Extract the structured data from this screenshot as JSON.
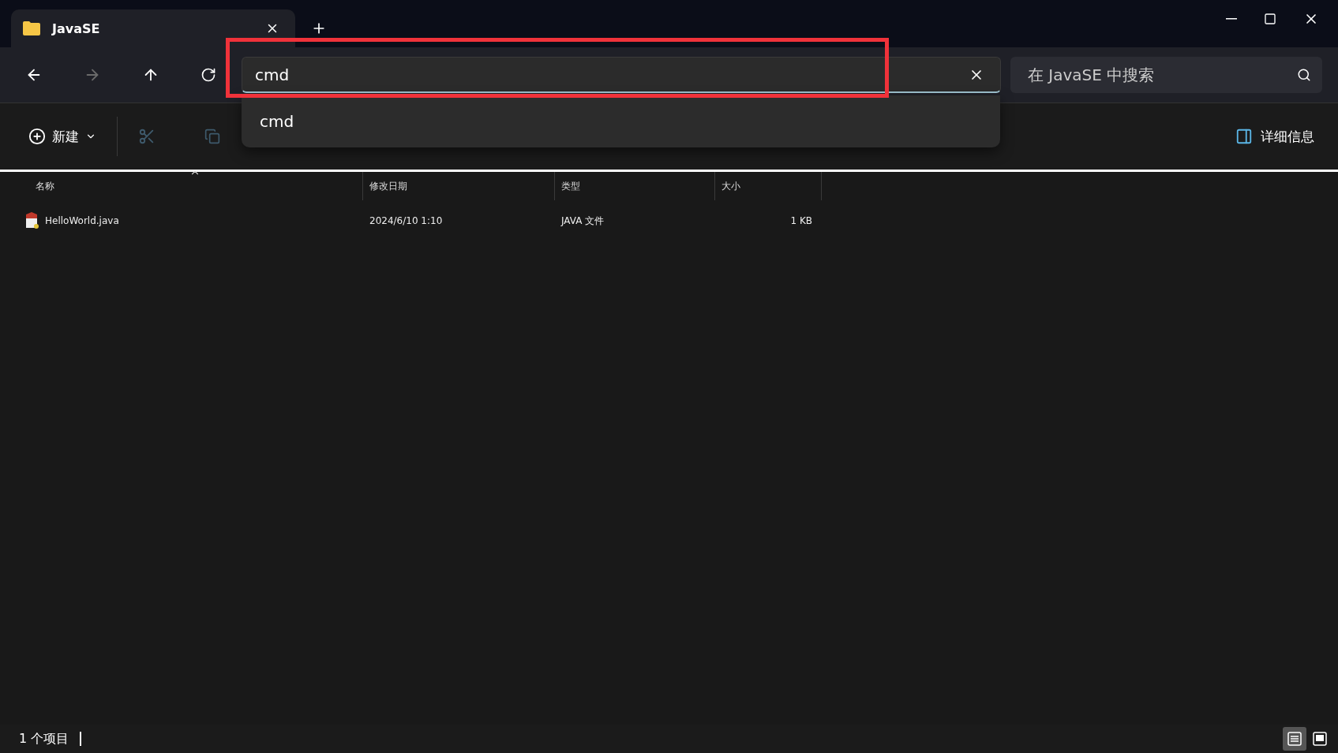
{
  "tab": {
    "title": "JavaSE",
    "selected": true
  },
  "address": {
    "value": "cmd",
    "suggestions": [
      "cmd"
    ]
  },
  "search": {
    "placeholder": "在 JavaSE 中搜索"
  },
  "toolbar": {
    "new_label": "新建",
    "details_label": "详细信息"
  },
  "table": {
    "columns": [
      {
        "label": "名称",
        "sorted": true
      },
      {
        "label": "修改日期",
        "sorted": false
      },
      {
        "label": "类型",
        "sorted": false
      },
      {
        "label": "大小",
        "sorted": false
      }
    ],
    "rows": [
      {
        "name": "HelloWorld.java",
        "modified": "2024/6/10 1:10",
        "type": "JAVA 文件",
        "size": "1 KB",
        "selected": false
      }
    ]
  },
  "status_bar": {
    "count": "1 个项目",
    "views": [
      {
        "kind": "details",
        "selected": true
      },
      {
        "kind": "tiles",
        "selected": false
      }
    ]
  }
}
